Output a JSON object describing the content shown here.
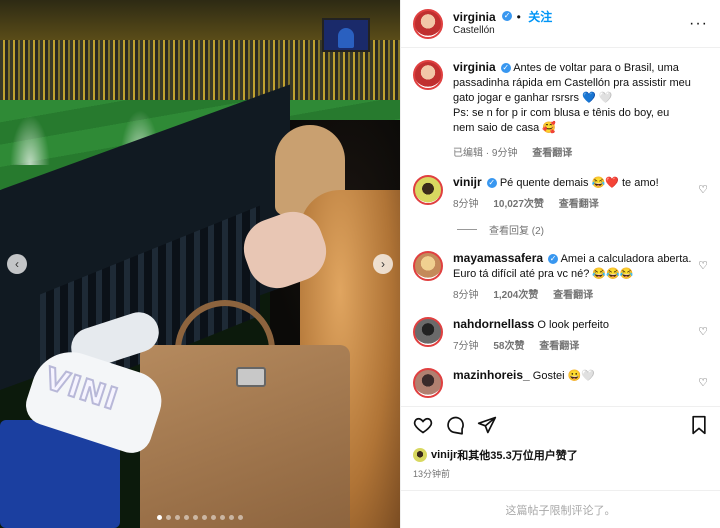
{
  "post": {
    "username": "virginia",
    "follow_label": "关注",
    "location": "Castellón"
  },
  "caption": {
    "username": "virginia",
    "text": "Antes de voltar para o Brasil, uma passadinha rápida em Castellón pra assistir meu gato jogar e ganhar rsrsrs 💙 🤍",
    "ps": "Ps: se n for p ir com blusa e tênis do boy, eu nem saio de casa 🥰",
    "edited": "已编辑 · 9分钟",
    "translate": "查看翻译"
  },
  "comments": [
    {
      "username": "vinijr",
      "verified": true,
      "text": "Pé quente demais 😂❤️ te amo!",
      "time": "8分钟",
      "likes": "10,027次赞",
      "translate": "查看翻译",
      "replies": "查看回复 (2)"
    },
    {
      "username": "mayamassafera",
      "verified": true,
      "text": "Amei a calculadora aberta. Euro tá difícil até pra vc né? 😂😂😂",
      "time": "8分钟",
      "likes": "1,204次赞",
      "translate": "查看翻译"
    },
    {
      "username": "nahdornellass",
      "verified": false,
      "text": "O look perfeito",
      "time": "7分钟",
      "likes": "58次赞",
      "translate": "查看翻译"
    },
    {
      "username": "mazinhoreis_",
      "verified": false,
      "text": "Gostei 😀🤍"
    }
  ],
  "likes": {
    "user": "vinijr",
    "text": "和其他35.3万位用户赞了",
    "time": "13分钟前"
  },
  "footer": {
    "limited_text": "这篇帖子限制评论了。"
  },
  "media": {
    "shoe_text": "VINI",
    "carousel_count": 10,
    "carousel_active": 1
  },
  "icons": {
    "verified": "verified-badge-icon",
    "more": "more-dots-icon",
    "like": "heart-icon",
    "comment": "comment-icon",
    "share": "share-icon",
    "save": "bookmark-icon"
  },
  "colors": {
    "accent": "#0095f6",
    "verified": "#3897f0",
    "meta": "#737373"
  }
}
